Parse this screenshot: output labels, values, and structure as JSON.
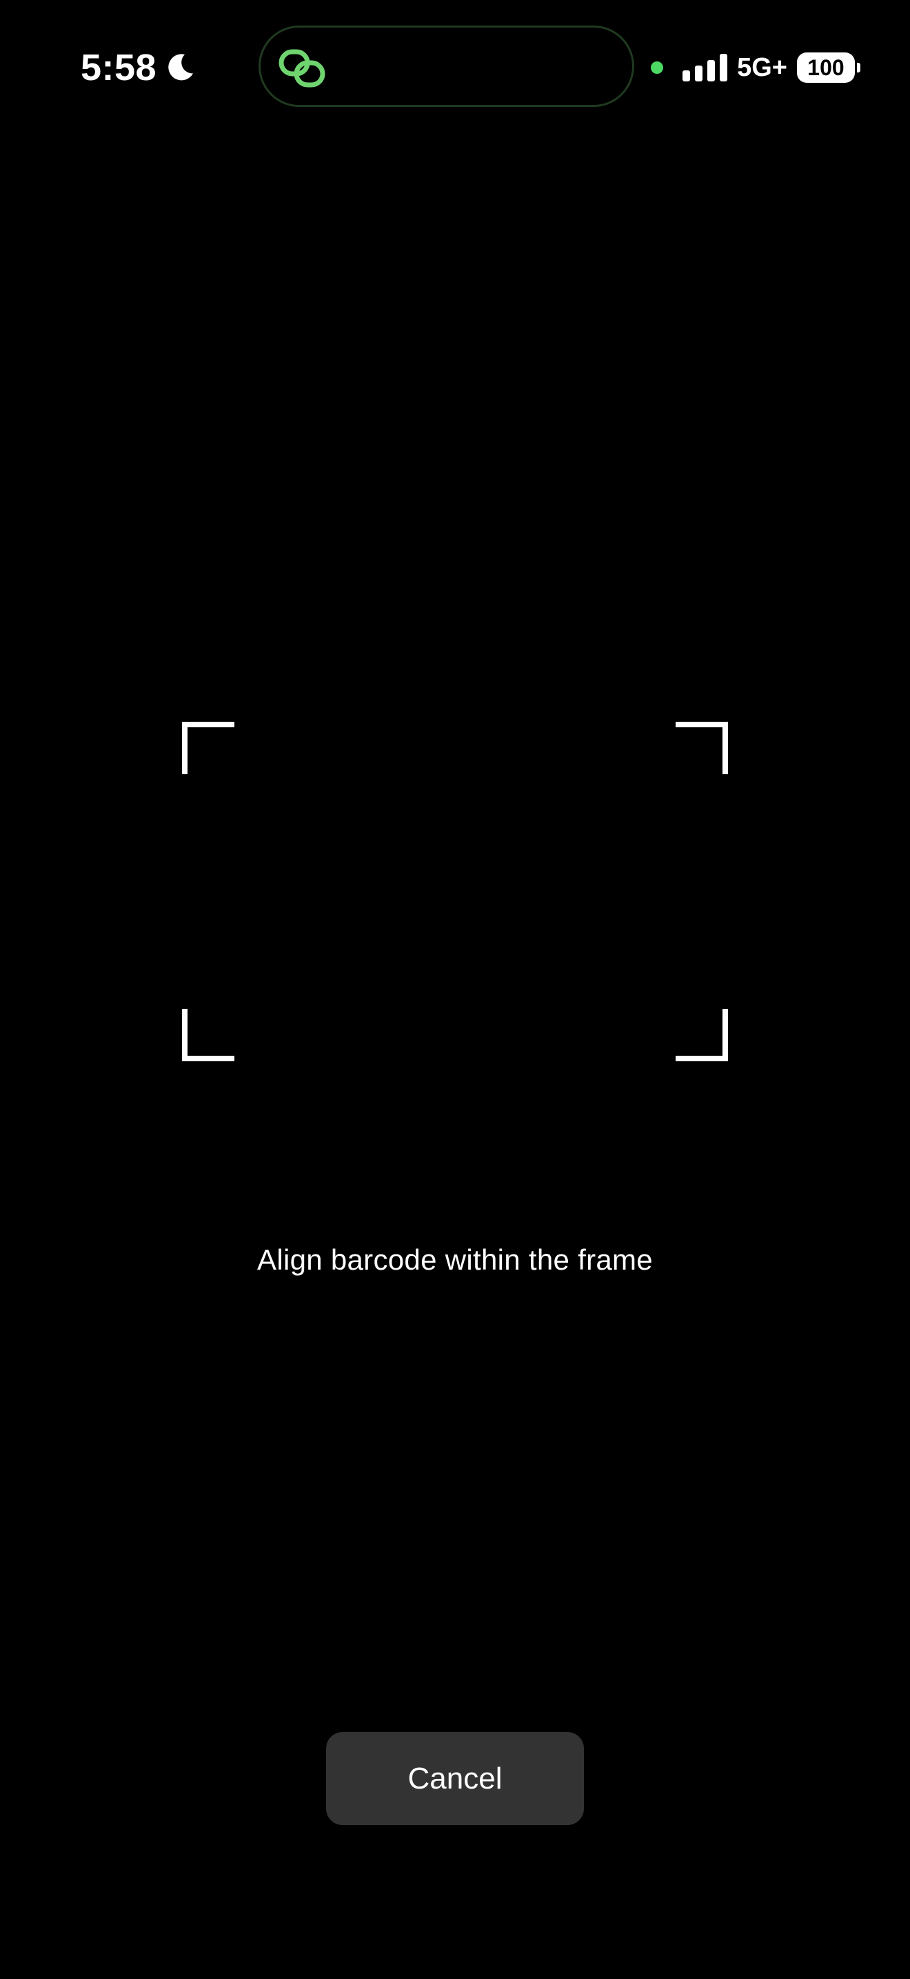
{
  "status_bar": {
    "time": "5:58",
    "focus_icon": "moon-icon",
    "dynamic_island_icon": "linked-rings-icon",
    "privacy_indicator_color": "#4cd964",
    "signal_bars_filled": 4,
    "network": "5G+",
    "battery_level": "100"
  },
  "scanner": {
    "frame_color": "#ffffff",
    "instruction": "Align barcode within the frame"
  },
  "actions": {
    "cancel_label": "Cancel"
  },
  "colors": {
    "background": "#000000",
    "accent_green": "#4cd964",
    "button_background": "#333333"
  }
}
